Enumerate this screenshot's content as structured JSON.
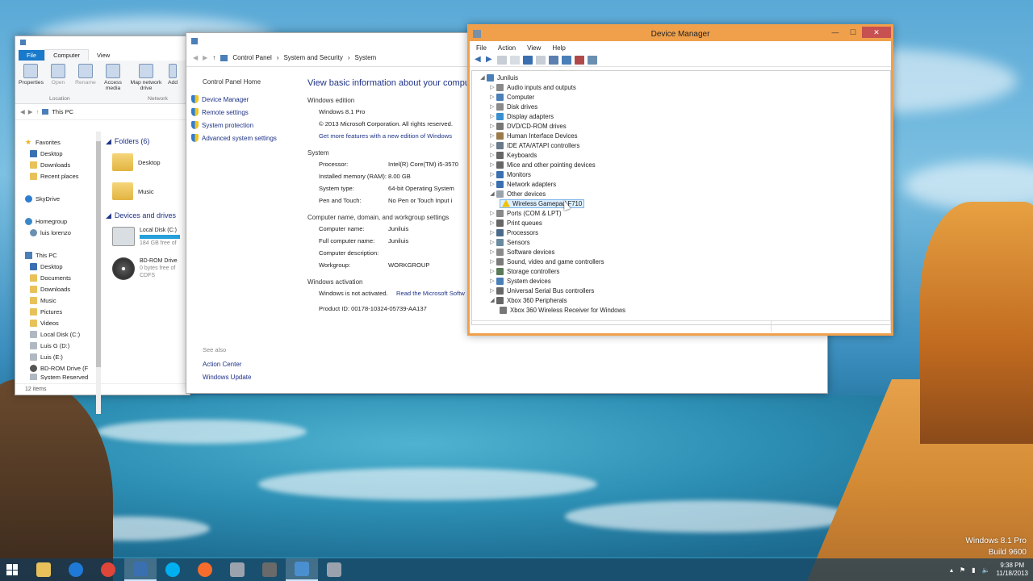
{
  "desktop": {
    "watermark_line1": "Windows 8.1 Pro",
    "watermark_line2": "Build 9600"
  },
  "explorer": {
    "tabs": [
      "File",
      "Computer",
      "View"
    ],
    "ribbon": {
      "items": [
        "Properties",
        "Open",
        "Rename",
        "Access media",
        "Map network drive",
        "Add"
      ],
      "group_location": "Location",
      "group_network": "Network"
    },
    "address": "This PC",
    "nav": {
      "favorites": "Favorites",
      "favorites_items": [
        "Desktop",
        "Downloads",
        "Recent places"
      ],
      "skydrive": "SkyDrive",
      "homegroup": "Homegroup",
      "homegroup_items": [
        "luis lorenzo"
      ],
      "this_pc": "This PC",
      "this_pc_items": [
        "Desktop",
        "Documents",
        "Downloads",
        "Music",
        "Pictures",
        "Videos",
        "Local Disk (C:)",
        "Luis G (D:)",
        "Luis (E:)",
        "BD-ROM Drive (F",
        "System Reserved"
      ]
    },
    "folders_header": "Folders (6)",
    "folders": [
      "Desktop",
      "Music"
    ],
    "devices_header": "Devices and drives",
    "drives": [
      {
        "name": "Local Disk (C:)",
        "sub": "184 GB free of"
      },
      {
        "name": "BD-ROM Drive",
        "sub": "0 bytes free of",
        "sub2": "CDFS"
      }
    ],
    "status": "12 items"
  },
  "system": {
    "address": [
      "Control Panel",
      "System and Security",
      "System"
    ],
    "left_home": "Control Panel Home",
    "left_links": [
      "Device Manager",
      "Remote settings",
      "System protection",
      "Advanced system settings"
    ],
    "see_also": "See also",
    "see_also_links": [
      "Action Center",
      "Windows Update"
    ],
    "title": "View basic information about your computer",
    "edition_head": "Windows edition",
    "edition": "Windows 8.1 Pro",
    "copyright": "© 2013 Microsoft Corporation. All rights reserved.",
    "more_features": "Get more features with a new edition of Windows",
    "system_head": "System",
    "system_rows": [
      {
        "k": "Processor:",
        "v": "Intel(R) Core(TM) i5-3570"
      },
      {
        "k": "Installed memory (RAM):",
        "v": "8.00 GB"
      },
      {
        "k": "System type:",
        "v": "64-bit Operating System"
      },
      {
        "k": "Pen and Touch:",
        "v": "No Pen or Touch Input i"
      }
    ],
    "name_head": "Computer name, domain, and workgroup settings",
    "name_rows": [
      {
        "k": "Computer name:",
        "v": "Juniluis"
      },
      {
        "k": "Full computer name:",
        "v": "Juniluis"
      },
      {
        "k": "Computer description:",
        "v": ""
      },
      {
        "k": "Workgroup:",
        "v": "WORKGROUP"
      }
    ],
    "activation_head": "Windows activation",
    "activation_status": "Windows is not activated.",
    "activation_link": "Read the Microsoft Softw",
    "product_id": "Product ID: 00178-10324-05739-AA137"
  },
  "devmgr": {
    "title": "Device Manager",
    "menu": [
      "File",
      "Action",
      "View",
      "Help"
    ],
    "root": "Juniluis",
    "categories": [
      {
        "label": "Audio inputs and outputs",
        "color": "#8a8a8a"
      },
      {
        "label": "Computer",
        "color": "#4a7fb8"
      },
      {
        "label": "Disk drives",
        "color": "#8a8a8a"
      },
      {
        "label": "Display adapters",
        "color": "#3a8fd0"
      },
      {
        "label": "DVD/CD-ROM drives",
        "color": "#777777"
      },
      {
        "label": "Human Interface Devices",
        "color": "#9a7a4a"
      },
      {
        "label": "IDE ATA/ATAPI controllers",
        "color": "#6a7a8a"
      },
      {
        "label": "Keyboards",
        "color": "#666666"
      },
      {
        "label": "Mice and other pointing devices",
        "color": "#666666"
      },
      {
        "label": "Monitors",
        "color": "#3a6fb0"
      },
      {
        "label": "Network adapters",
        "color": "#3a6fb0"
      }
    ],
    "other_devices": "Other devices",
    "selected_device": "Wireless Gamepad F710",
    "categories_after": [
      {
        "label": "Ports (COM & LPT)",
        "color": "#888888"
      },
      {
        "label": "Print queues",
        "color": "#666666"
      },
      {
        "label": "Processors",
        "color": "#4a6a8a"
      },
      {
        "label": "Sensors",
        "color": "#6a8aa0"
      },
      {
        "label": "Software devices",
        "color": "#8a8a8a"
      },
      {
        "label": "Sound, video and game controllers",
        "color": "#7a7a7a"
      },
      {
        "label": "Storage controllers",
        "color": "#5a7a5a"
      },
      {
        "label": "System devices",
        "color": "#4a7fb8"
      },
      {
        "label": "Universal Serial Bus controllers",
        "color": "#666666"
      }
    ],
    "xbox_category": "Xbox 360 Peripherals",
    "xbox_device": "Xbox 360 Wireless Receiver for Windows"
  },
  "taskbar": {
    "apps": [
      {
        "name": "file-explorer",
        "color": "#e8c15a"
      },
      {
        "name": "internet-explorer",
        "color": "#1e7ad6"
      },
      {
        "name": "chrome",
        "color": "#e0453a"
      },
      {
        "name": "system-window",
        "color": "#3a6fb0"
      },
      {
        "name": "skype",
        "color": "#00aff0"
      },
      {
        "name": "origin",
        "color": "#f56c2d"
      },
      {
        "name": "device-tool",
        "color": "#9aa3ad"
      },
      {
        "name": "app-8",
        "color": "#6a6a6a"
      },
      {
        "name": "app-9",
        "color": "#4a8fd0"
      },
      {
        "name": "device-manager",
        "color": "#9aa3ad"
      }
    ],
    "time": "9:38 PM",
    "date": "11/18/2013"
  }
}
